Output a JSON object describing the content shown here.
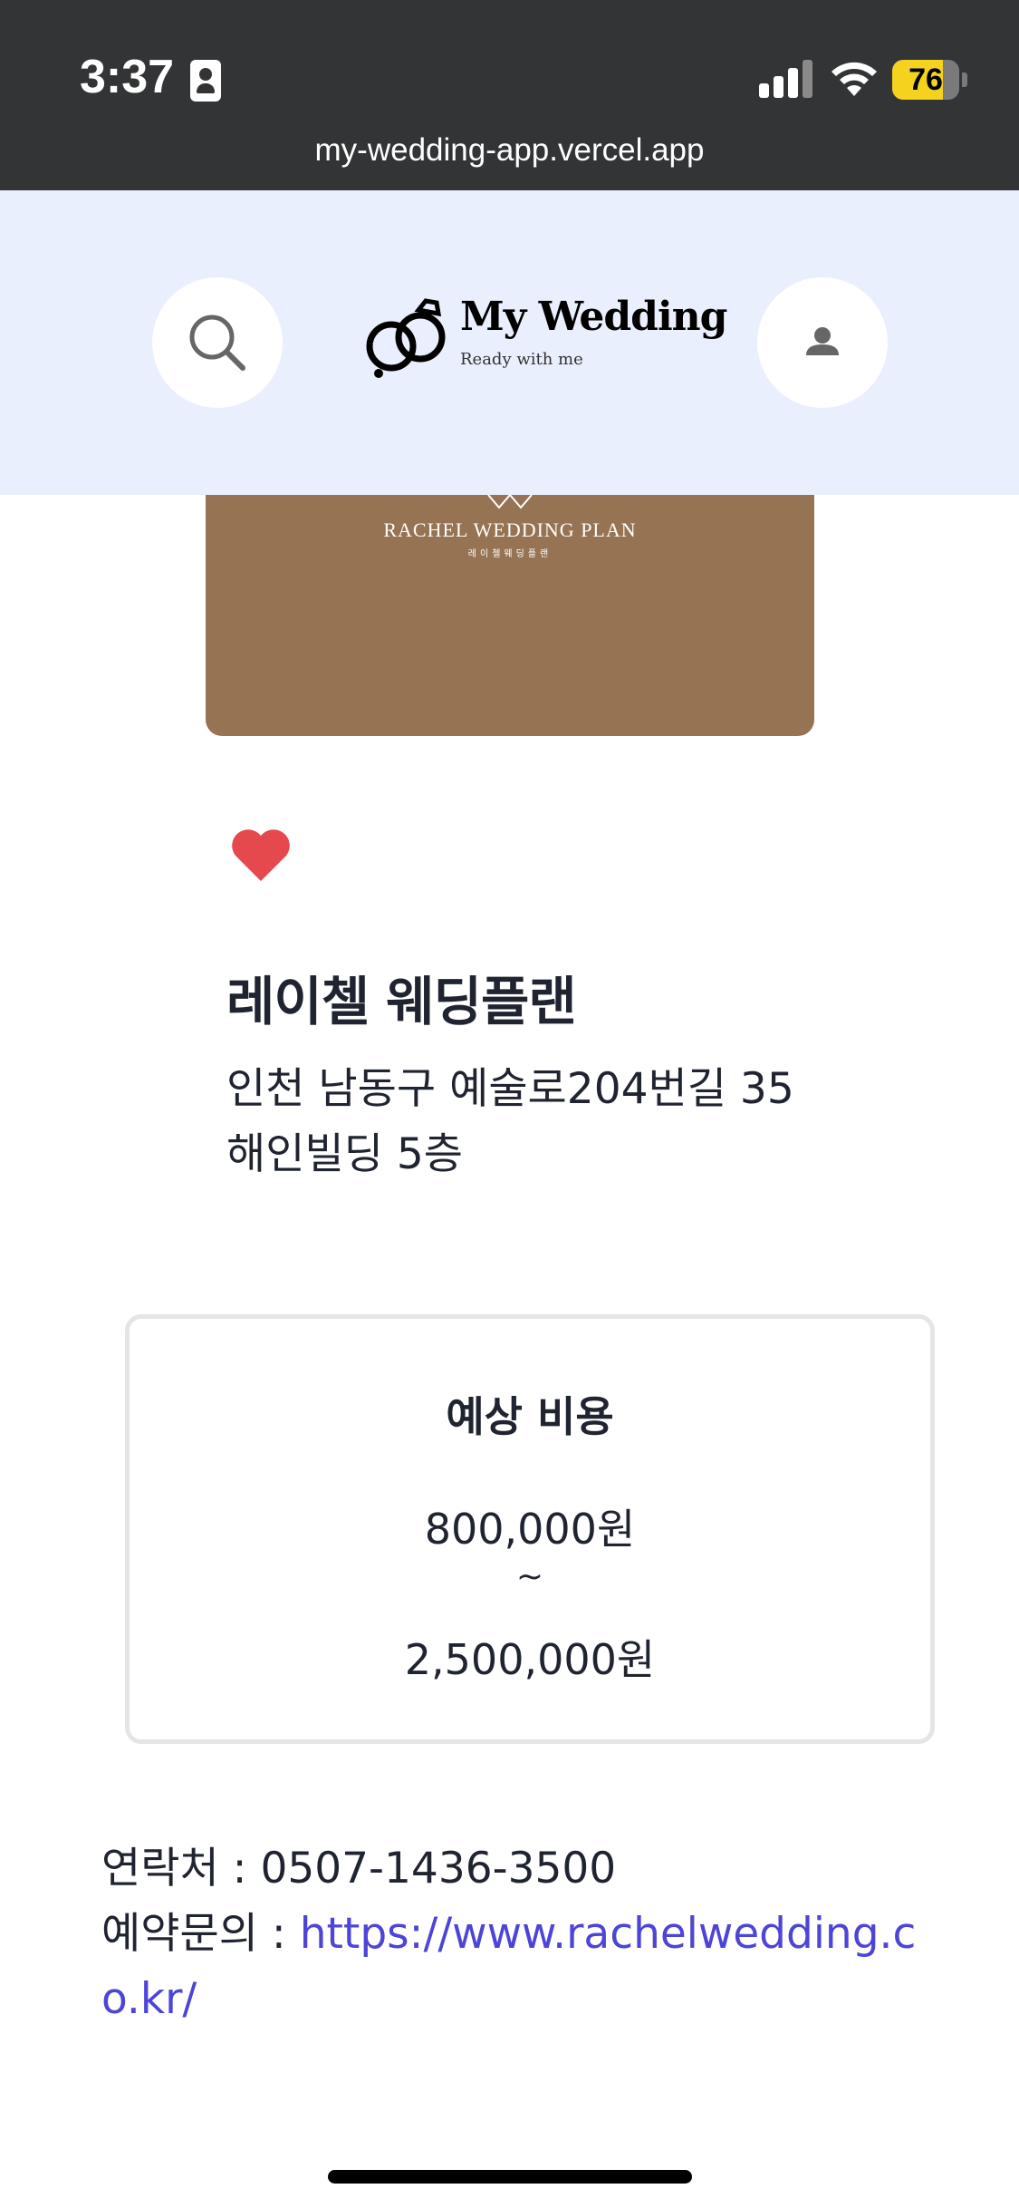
{
  "status_bar": {
    "time": "3:37",
    "battery": "76",
    "battery_level": 0.76,
    "url": "my-wedding-app.vercel.app"
  },
  "header": {
    "logo_title": "My Wedding",
    "logo_subtitle": "Ready with me",
    "search_icon": "search-icon",
    "profile_icon": "person-icon"
  },
  "banner": {
    "title": "RACHEL WEDDING PLAN",
    "subtitle": "레이첼웨딩플랜",
    "color": "#967353"
  },
  "vendor": {
    "favorite_icon": "heart-icon",
    "favorite_color": "#e5484d",
    "name": "레이첼 웨딩플랜",
    "address_line1": "인천 남동구 예술로204번길 35",
    "address_line2": "해인빌딩 5층"
  },
  "cost": {
    "title": "예상 비용",
    "min": "800,000원",
    "separator": "~",
    "max": "2,500,000원"
  },
  "contact": {
    "phone_label": "연락처 : ",
    "phone": "0507-1436-3500",
    "reservation_label": "예약문의 : ",
    "reservation_url": "https://www.rachelwedding.co.kr/"
  },
  "colors": {
    "header_bg": "#eaeffd",
    "status_bg": "#323436",
    "link": "#4d44d8"
  }
}
